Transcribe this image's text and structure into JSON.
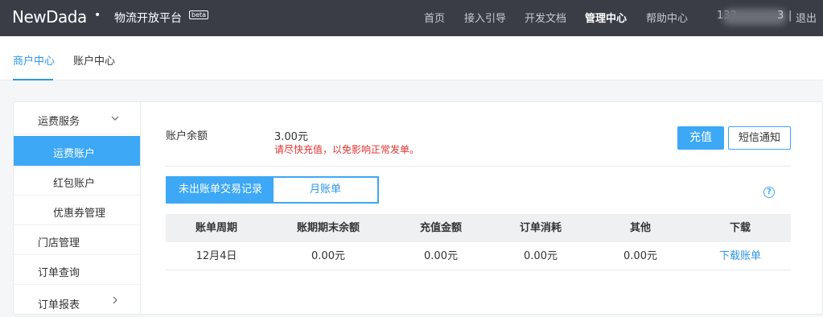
{
  "header": {
    "logo": "NewDada",
    "logo_dot": "•",
    "platform": "物流开放平台",
    "badge": "beta",
    "nav": [
      "首页",
      "接入引导",
      "开发文档",
      "管理中心",
      "帮助中心"
    ],
    "active_nav": "管理中心",
    "user_prefix": "133",
    "user_suffix": "3",
    "separator": "|",
    "logout": "退出"
  },
  "subnav": {
    "tabs": [
      "商户中心",
      "账户中心"
    ],
    "active": "商户中心"
  },
  "sidebar": {
    "items": [
      {
        "label": "运费服务",
        "level": 1,
        "chevron": "chevron-down"
      },
      {
        "label": "运费账户",
        "level": 2,
        "active": true
      },
      {
        "label": "红包账户",
        "level": 2
      },
      {
        "label": "优惠券管理",
        "level": 2
      },
      {
        "label": "门店管理",
        "level": 1
      },
      {
        "label": "订单查询",
        "level": 1
      },
      {
        "label": "订单报表",
        "level": 1,
        "chevron": "chevron-right"
      }
    ]
  },
  "main": {
    "balance_label": "账户余额",
    "balance_amount": "3.00元",
    "balance_warning": "请尽快充值，以免影响正常发单。",
    "charge_button": "充值",
    "sms_button": "短信通知",
    "tabs": [
      "未出账单交易记录",
      "月账单"
    ],
    "active_tab": "未出账单交易记录",
    "help_icon": "?",
    "table": {
      "headers": [
        "账单周期",
        "账期期末余额",
        "充值金额",
        "订单消耗",
        "其他",
        "下载"
      ],
      "rows": [
        [
          "12月4日",
          "0.00元",
          "0.00元",
          "0.00元",
          "0.00元",
          "下载账单"
        ]
      ]
    }
  },
  "colors": {
    "topbar": "#3a3d45",
    "accent": "#3da8f5",
    "warning": "#e0322f"
  }
}
